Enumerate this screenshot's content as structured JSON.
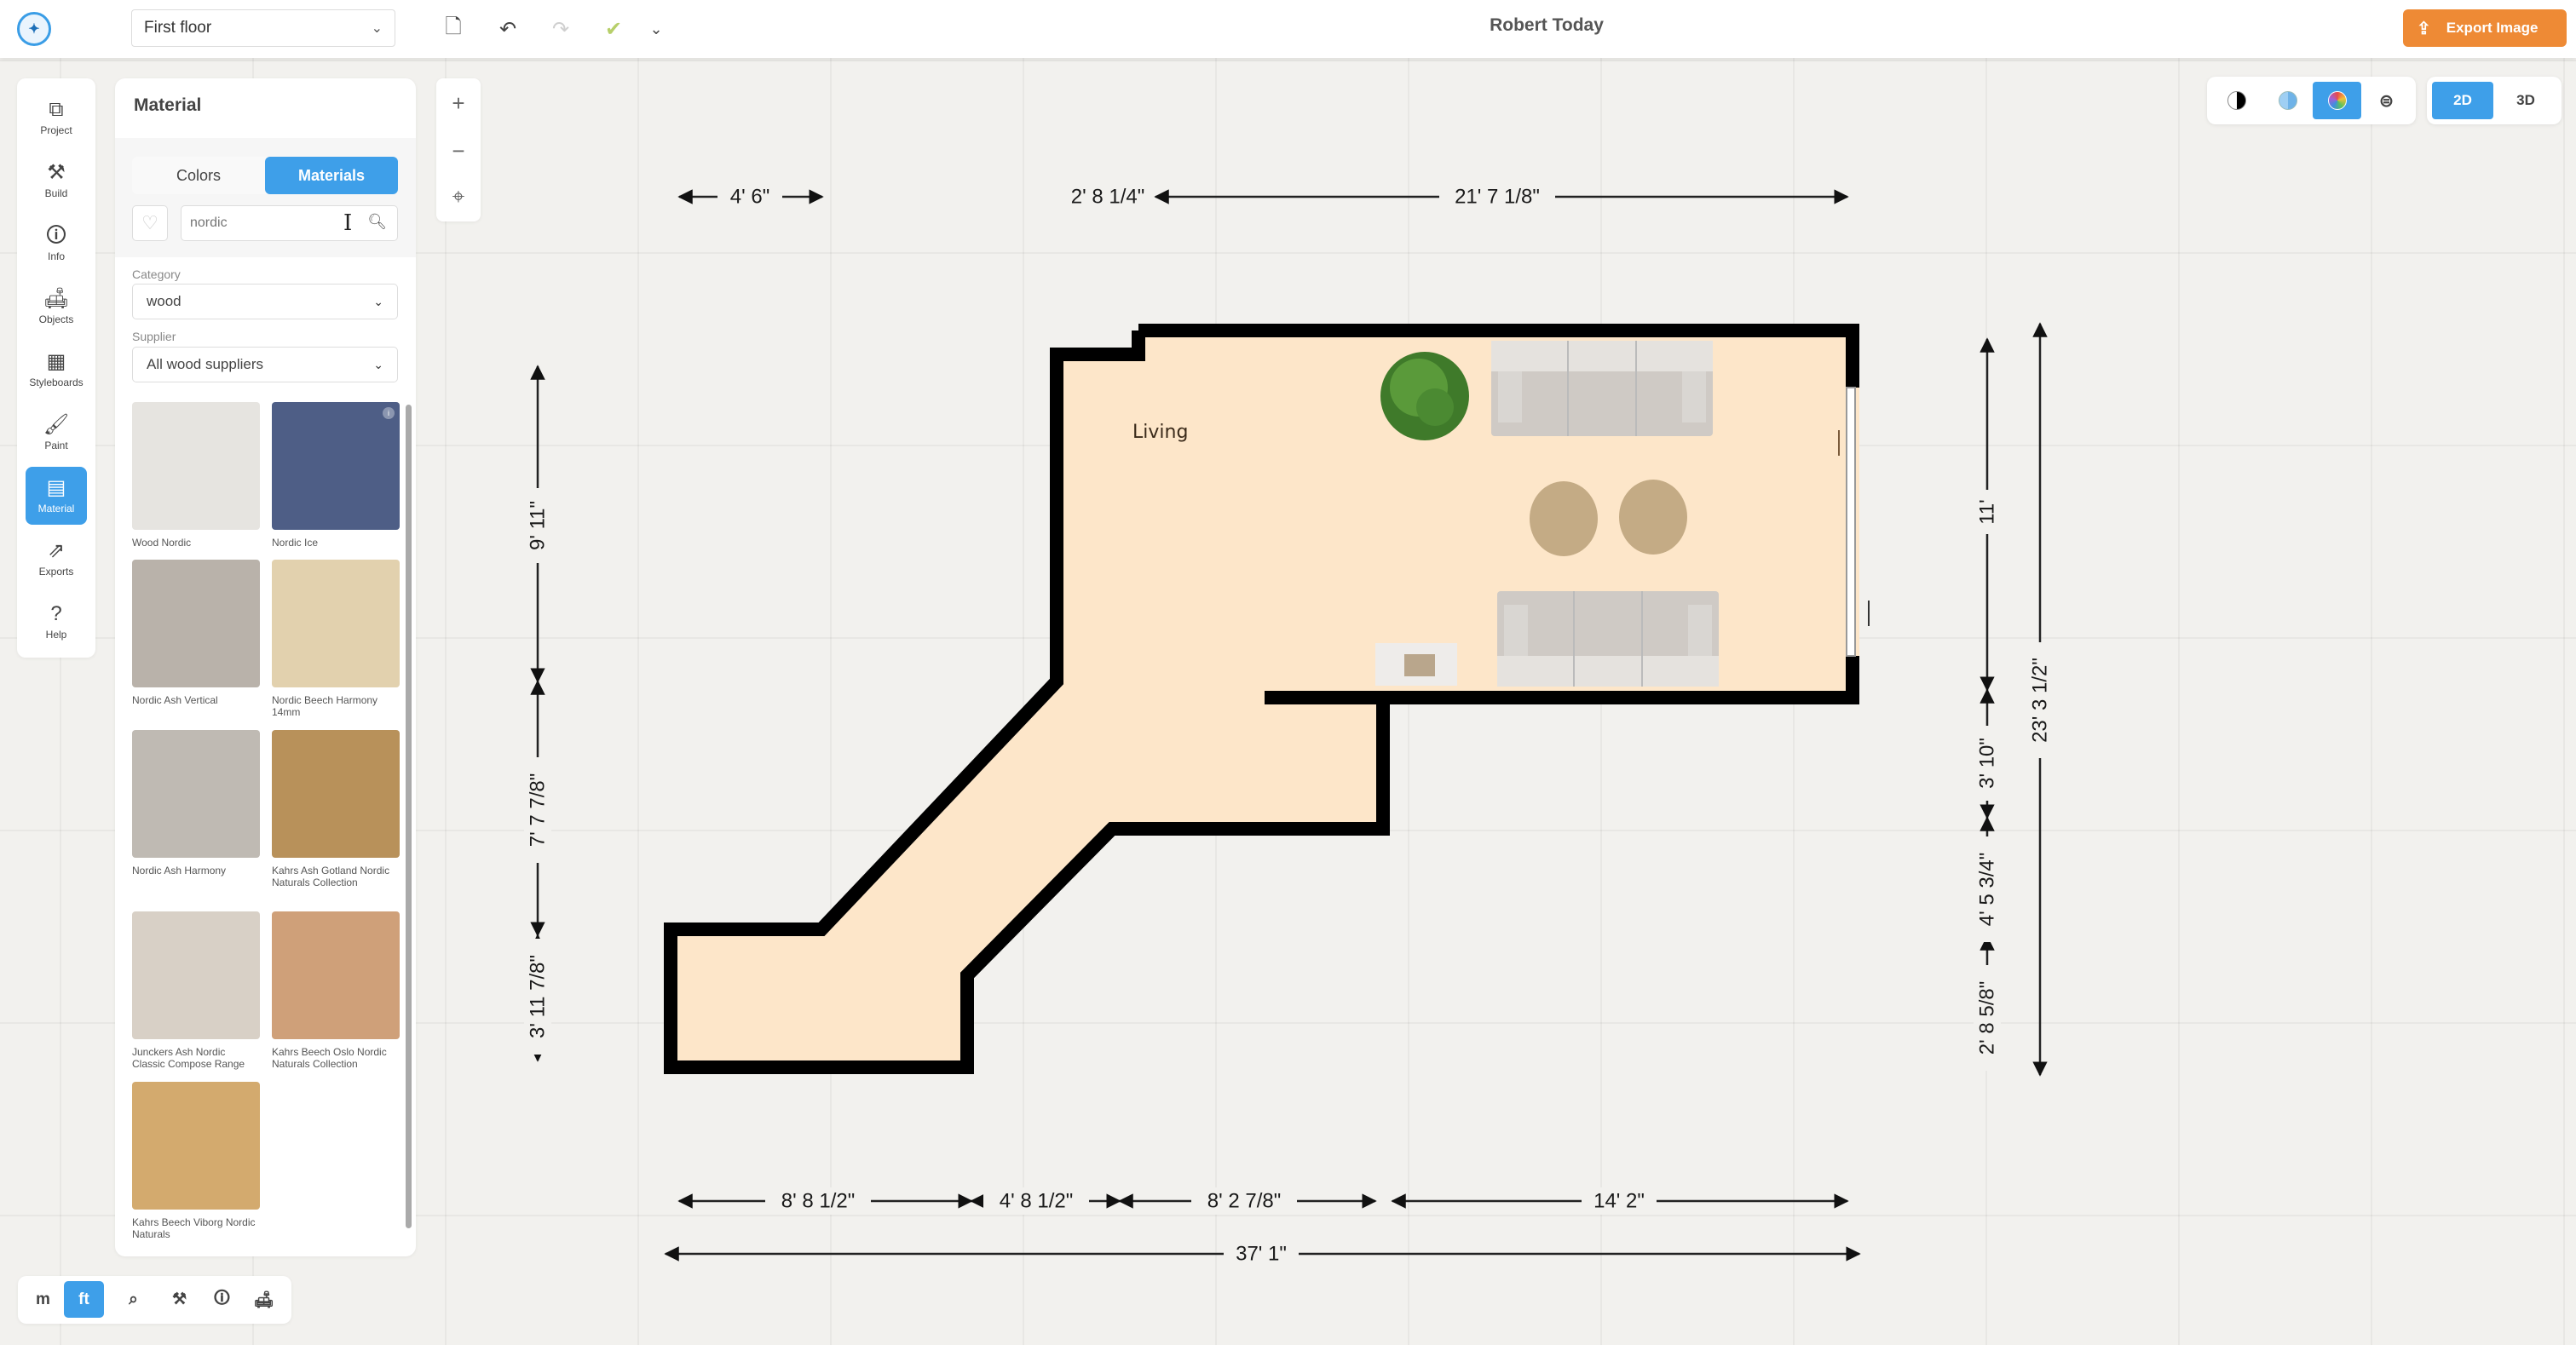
{
  "topbar": {
    "logo_icon": "planner-logo-icon",
    "floor_select": {
      "value": "First floor",
      "icon": "chevron-down-icon"
    },
    "tools": [
      {
        "name": "new-page",
        "glyph": "🗋",
        "disabled": false
      },
      {
        "name": "undo",
        "glyph": "↶",
        "disabled": false
      },
      {
        "name": "redo",
        "glyph": "↷",
        "disabled": true
      },
      {
        "name": "save",
        "glyph": "💾",
        "disabled": true
      },
      {
        "name": "more",
        "glyph": "⌄",
        "disabled": false
      }
    ],
    "project_title": "Robert Today",
    "export_label": "Export Image",
    "colors": {
      "accent": "#3e9fe9",
      "export": "#ee8a35"
    }
  },
  "leftnav": {
    "items": [
      {
        "label": "Project",
        "glyph": "⧉",
        "active": false
      },
      {
        "label": "Build",
        "glyph": "⚒",
        "active": false
      },
      {
        "label": "Info",
        "glyph": "🛈",
        "active": false
      },
      {
        "label": "Objects",
        "glyph": "🛋",
        "active": false
      },
      {
        "label": "Styleboards",
        "glyph": "▦",
        "active": false
      },
      {
        "label": "Paint",
        "glyph": "🖌",
        "active": false
      },
      {
        "label": "Material",
        "glyph": "▤",
        "active": true
      },
      {
        "label": "Exports",
        "glyph": "⇗",
        "active": false
      },
      {
        "label": "Help",
        "glyph": "?",
        "active": false
      }
    ]
  },
  "material_panel": {
    "title": "Material",
    "tabs": [
      {
        "label": "Colors",
        "active": false
      },
      {
        "label": "Materials",
        "active": true
      }
    ],
    "search": {
      "value": "",
      "placeholder": "nordic"
    },
    "category": {
      "label": "Category",
      "value": "wood"
    },
    "supplier": {
      "label": "Supplier",
      "value": "All wood suppliers"
    },
    "materials": [
      {
        "name": "Wood Nordic",
        "color": "#e6e4e0"
      },
      {
        "name": "Nordic Ice",
        "color": "#4e5e86"
      },
      {
        "name": "Nordic Ash Vertical",
        "color": "#b9b2aa"
      },
      {
        "name": "Nordic Beech Harmony 14mm",
        "color": "#e2d1ae"
      },
      {
        "name": "Nordic Ash Harmony",
        "color": "#bfbab3"
      },
      {
        "name": "Kahrs Ash Gotland Nordic Naturals Collection",
        "color": "#b8915a"
      },
      {
        "name": "Junckers Ash Nordic Classic Compose Range",
        "color": "#d8d0c6"
      },
      {
        "name": "Kahrs Beech Oslo Nordic Naturals Collection",
        "color": "#cfa079"
      },
      {
        "name": "Kahrs Beech Viborg Nordic Naturals",
        "color": "#d3aa6e"
      }
    ]
  },
  "bottombar": {
    "units": [
      {
        "label": "m",
        "active": false
      },
      {
        "label": "ft",
        "active": true
      }
    ],
    "tools": [
      {
        "name": "measure",
        "glyph": "⌕"
      },
      {
        "name": "build",
        "glyph": "⚒"
      },
      {
        "name": "info",
        "glyph": "🛈"
      },
      {
        "name": "objects",
        "glyph": "🛋"
      }
    ]
  },
  "zoom_controls": {
    "zoom_in": "+",
    "zoom_out": "−",
    "recenter": "⌖"
  },
  "view_modes": {
    "color_modes": [
      {
        "name": "contrast",
        "active": false
      },
      {
        "name": "blueprint",
        "active": false
      },
      {
        "name": "full-color",
        "active": true
      },
      {
        "name": "toggles",
        "active": false
      }
    ],
    "dimension": [
      {
        "label": "2D",
        "active": true
      },
      {
        "label": "3D",
        "active": false
      }
    ]
  },
  "floor_plan": {
    "room_label": "Living",
    "floor_color": "#fde6c9",
    "wall_color": "#000000",
    "dimensions": {
      "top": [
        "4' 6\"",
        "2' 8 1/4\"",
        "21' 7 1/8\""
      ],
      "bottom": [
        "8' 8 1/2\"",
        "4' 8 1/2\"",
        "8' 2 7/8\"",
        "14' 2\""
      ],
      "bottom_total": "37' 1\"",
      "left": [
        "9' 11\"",
        "7' 7 7/8\"",
        "3' 11 7/8\""
      ],
      "right": [
        "11'",
        "3' 10\"",
        "4' 5 3/4\"",
        "2' 8 5/8\""
      ],
      "right_total": "23' 3 1/2\""
    },
    "furniture": [
      "plant",
      "sofa-top",
      "ottoman",
      "ottoman",
      "sofa-bottom",
      "side-table"
    ]
  }
}
